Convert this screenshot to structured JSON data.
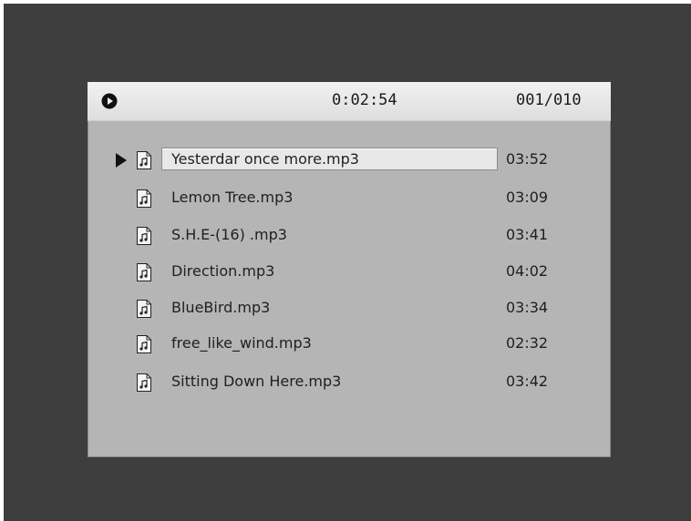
{
  "header": {
    "play_icon": "play-circle-icon",
    "elapsed": "0:02:54",
    "counter": "001/010"
  },
  "tracks": [
    {
      "name": "Yesterdar once more.mp3",
      "duration": "03:52",
      "selected": true
    },
    {
      "name": "Lemon Tree.mp3",
      "duration": "03:09"
    },
    {
      "name": "S.H.E-(16) .mp3",
      "duration": "03:41"
    },
    {
      "name": "Direction.mp3",
      "duration": "04:02"
    },
    {
      "name": "BlueBird.mp3",
      "duration": "03:34"
    },
    {
      "name": "free_like_wind.mp3",
      "duration": "02:32"
    },
    {
      "name": "Sitting Down Here.mp3",
      "duration": "03:42"
    }
  ],
  "icons": {
    "cursor": "play-cursor-icon",
    "file": "music-file-icon"
  },
  "colors": {
    "screen": "#3e3e3e",
    "panel": "#b5b5b5",
    "header": "#e8e8e8",
    "highlight": "#e8e8e8"
  }
}
